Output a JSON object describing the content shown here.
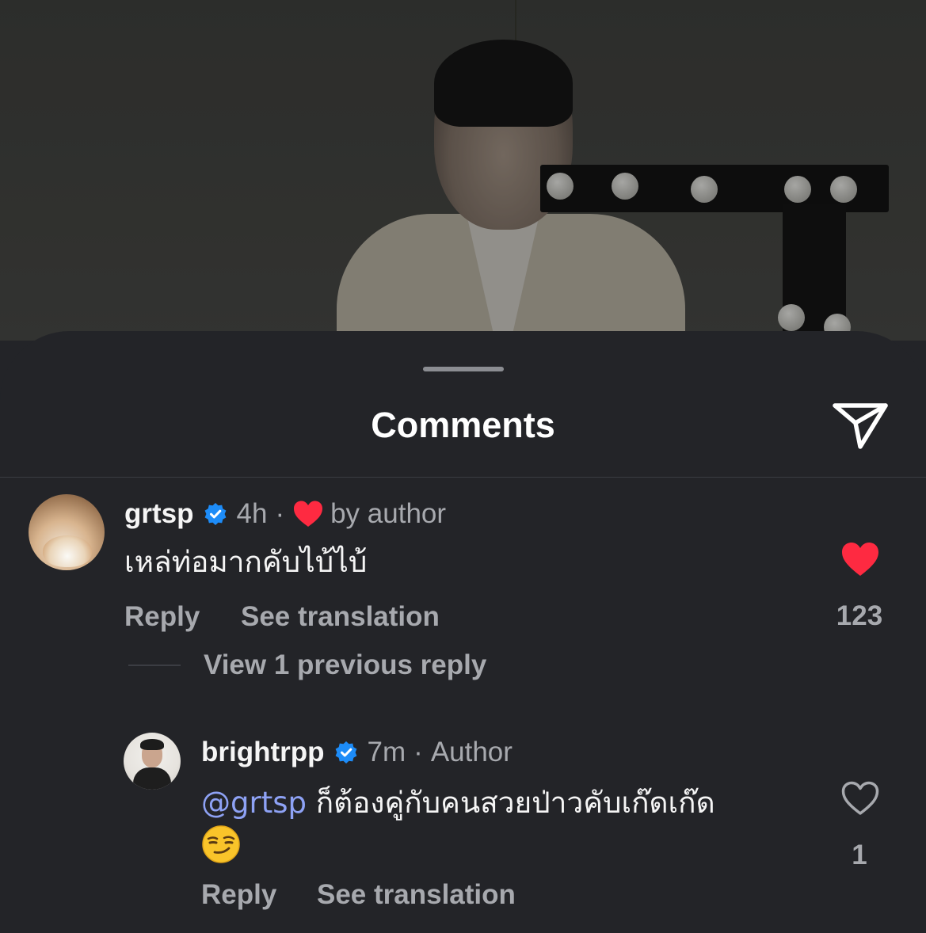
{
  "sheet": {
    "title": "Comments"
  },
  "comments": [
    {
      "username": "grtsp",
      "time": "4h",
      "separator": "·",
      "liked_by_author_label": "by author",
      "text": "เหล่ท่อมากคับไบ้ไบ้",
      "reply_label": "Reply",
      "translate_label": "See translation",
      "like_count": "123",
      "liked": true,
      "view_replies_label": "View 1 previous reply"
    },
    {
      "username": "brightrpp",
      "time": "7m",
      "separator": "·",
      "author_label": "Author",
      "mention": "@grtsp",
      "text": "ก็ต้องคู่กับคนสวยป่าวคับเก๊ดเก๊ด",
      "emoji": "smirking-face",
      "reply_label": "Reply",
      "translate_label": "See translation",
      "like_count": "1",
      "liked": false
    }
  ],
  "colors": {
    "background": "#232428",
    "verified": "#1d8cf8",
    "heart": "#fe2a41",
    "mention": "#8ea2f5",
    "muted_text": "#a7a9ae"
  }
}
